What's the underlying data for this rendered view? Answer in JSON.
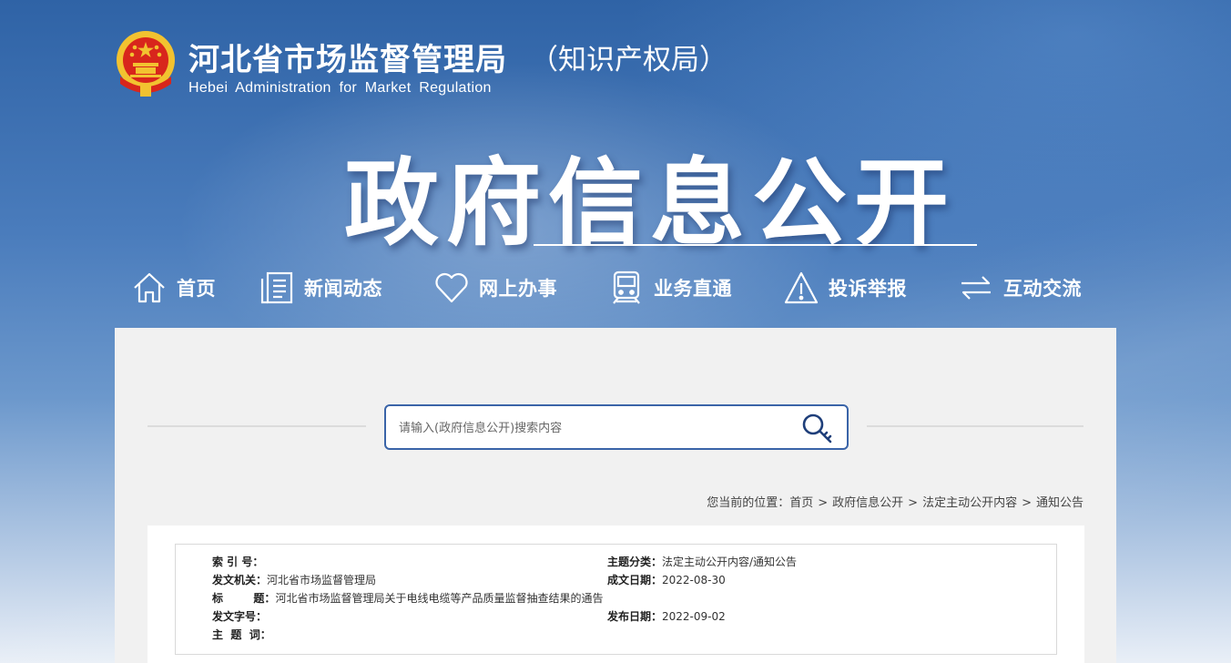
{
  "header": {
    "title": "河北省市场监督管理局",
    "title_suffix": "（知识产权局）",
    "subtitle": "Hebei Administration for Market Regulation",
    "hero_title": "政府信息公开"
  },
  "nav": [
    {
      "label": "首页",
      "icon": "home-icon"
    },
    {
      "label": "新闻动态",
      "icon": "document-list-icon"
    },
    {
      "label": "网上办事",
      "icon": "heart-icon"
    },
    {
      "label": "业务直通",
      "icon": "train-icon"
    },
    {
      "label": "投诉举报",
      "icon": "warning-icon"
    },
    {
      "label": "互动交流",
      "icon": "exchange-arrows-icon"
    }
  ],
  "search": {
    "placeholder": "请输入(政府信息公开)搜索内容",
    "button_icon": "search-key-icon"
  },
  "breadcrumb": {
    "prefix": "您当前的位置：",
    "items": [
      "首页",
      "政府信息公开",
      "法定主动公开内容",
      "通知公告"
    ],
    "separator": ">"
  },
  "info": {
    "index_label": "索  引  号：",
    "index_value": "",
    "category_label": "主题分类：",
    "category_value": "法定主动公开内容/通知公告",
    "issuer_label": "发文机关：",
    "issuer_value": "河北省市场监督管理局",
    "created_label": "成文日期：",
    "created_value": "2022-08-30",
    "title_label": "标        题：",
    "title_value": "河北省市场监督管理局关于电线电缆等产品质量监督抽查结果的通告",
    "docno_label": "发文字号：",
    "docno_value": "",
    "published_label": "发布日期：",
    "published_value": "2022-09-02",
    "keywords_label": "主  题  词：",
    "keywords_value": ""
  },
  "colors": {
    "brand_blue": "#3a64a8",
    "emblem_red": "#d8261c",
    "emblem_gold": "#f2c230"
  }
}
